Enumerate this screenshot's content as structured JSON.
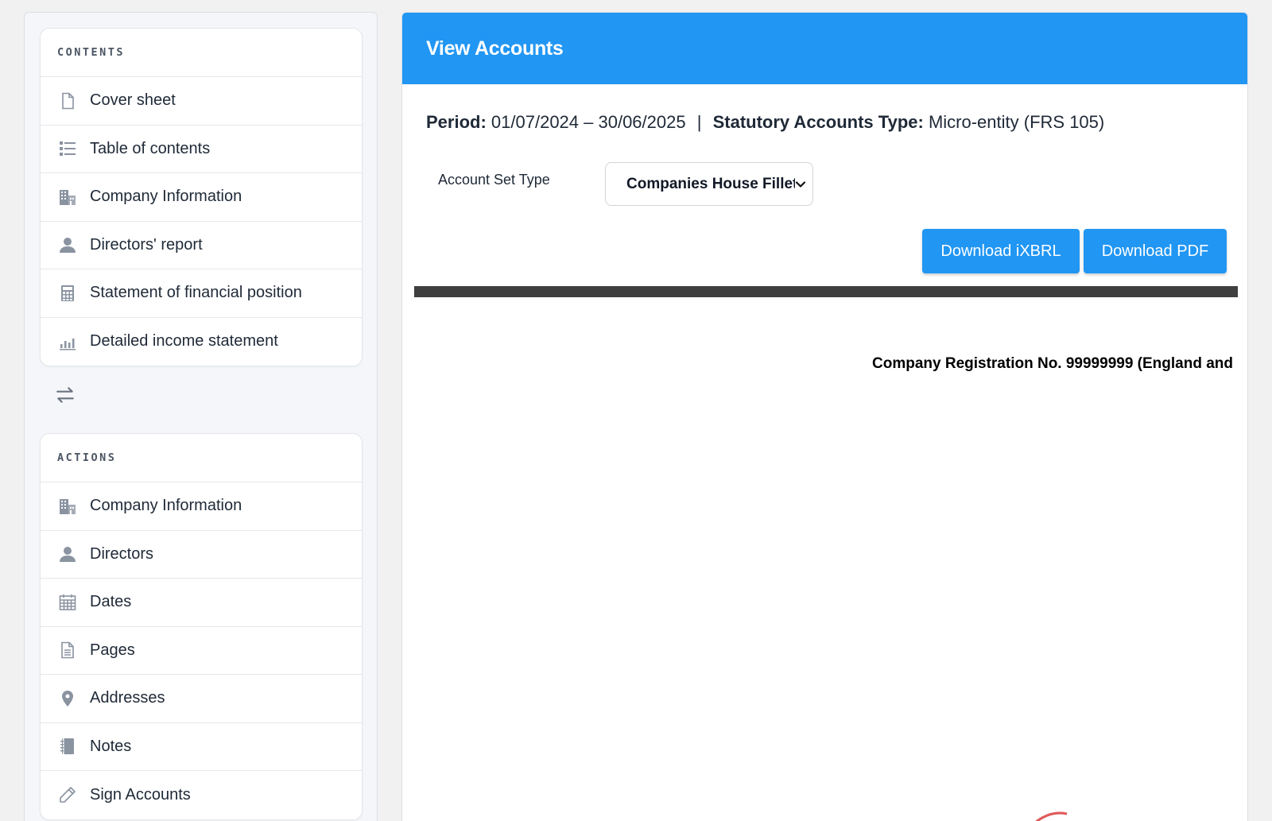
{
  "sidebar": {
    "contents": {
      "header": "CONTENTS",
      "items": [
        {
          "label": "Cover sheet",
          "icon": "file-icon"
        },
        {
          "label": "Table of contents",
          "icon": "list-icon"
        },
        {
          "label": "Company Information",
          "icon": "building-icon"
        },
        {
          "label": "Directors' report",
          "icon": "user-icon"
        },
        {
          "label": "Statement of financial position",
          "icon": "calculator-icon"
        },
        {
          "label": "Detailed income statement",
          "icon": "bar-chart-icon"
        }
      ]
    },
    "swap_icon": "swap-arrows-icon",
    "actions": {
      "header": "ACTIONS",
      "items": [
        {
          "label": "Company Information",
          "icon": "building-icon"
        },
        {
          "label": "Directors",
          "icon": "user-icon"
        },
        {
          "label": "Dates",
          "icon": "calendar-icon"
        },
        {
          "label": "Pages",
          "icon": "document-icon"
        },
        {
          "label": "Addresses",
          "icon": "map-pin-icon"
        },
        {
          "label": "Notes",
          "icon": "notebook-icon"
        },
        {
          "label": "Sign Accounts",
          "icon": "pencil-icon"
        }
      ]
    }
  },
  "main": {
    "title": "View Accounts",
    "period_label": "Period:",
    "period_value": "01/07/2024 – 30/06/2025",
    "separator": "|",
    "type_label": "Statutory Accounts Type:",
    "type_value": "Micro-entity (FRS 105)",
    "account_set_label": "Account Set Type",
    "account_set_selected": "Companies House Filleted",
    "download_ixbrl": "Download iXBRL",
    "download_pdf": "Download PDF",
    "registration": "Company Registration No. 99999999 (England and"
  },
  "colors": {
    "accent": "#2196f3",
    "icon_gray": "#8a93a0",
    "stamp": "#e05a5a"
  }
}
